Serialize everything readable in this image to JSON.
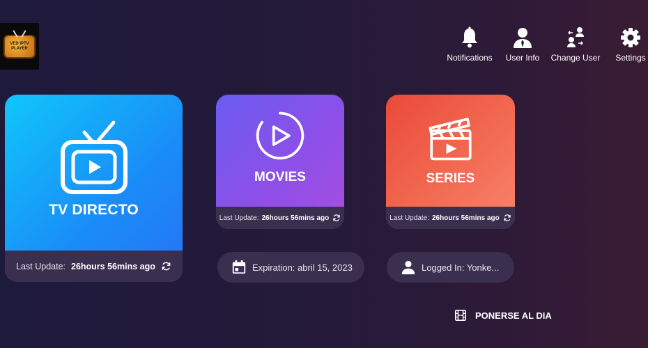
{
  "logo": {
    "text_line1": "VED IPTV",
    "text_line2": "PLAYER"
  },
  "nav": {
    "notifications": "Notifications",
    "user_info": "User Info",
    "change_user": "Change User",
    "settings": "Settings"
  },
  "cards": {
    "tv": {
      "title": "TV DIRECTO",
      "update_label": "Last Update:",
      "update_value": "26hours 56mins ago",
      "color_start": "#10c6fa",
      "color_end": "#2673f5"
    },
    "movies": {
      "title": "MOVIES",
      "update_label": "Last Update:",
      "update_value": "26hours 56mins ago",
      "color_start": "#6b5cf0",
      "color_end": "#a74fe0"
    },
    "series": {
      "title": "SERIES",
      "update_label": "Last Update:",
      "update_value": "26hours 56mins ago",
      "color_start": "#ea4a39",
      "color_end": "#f9846c"
    }
  },
  "expiration": "Expiration: abril 15, 2023",
  "logged_in": "Logged In: Yonke...",
  "update_button": "PONERSE AL DIA",
  "icons": {
    "notifications": "bell-icon",
    "user_info": "user-icon",
    "change_user": "switch-user-icon",
    "settings": "gear-icon",
    "tv": "tv-icon",
    "movies": "play-circle-icon",
    "series": "clapperboard-icon",
    "refresh": "refresh-icon",
    "calendar": "calendar-icon",
    "person": "person-icon",
    "film": "film-icon"
  }
}
